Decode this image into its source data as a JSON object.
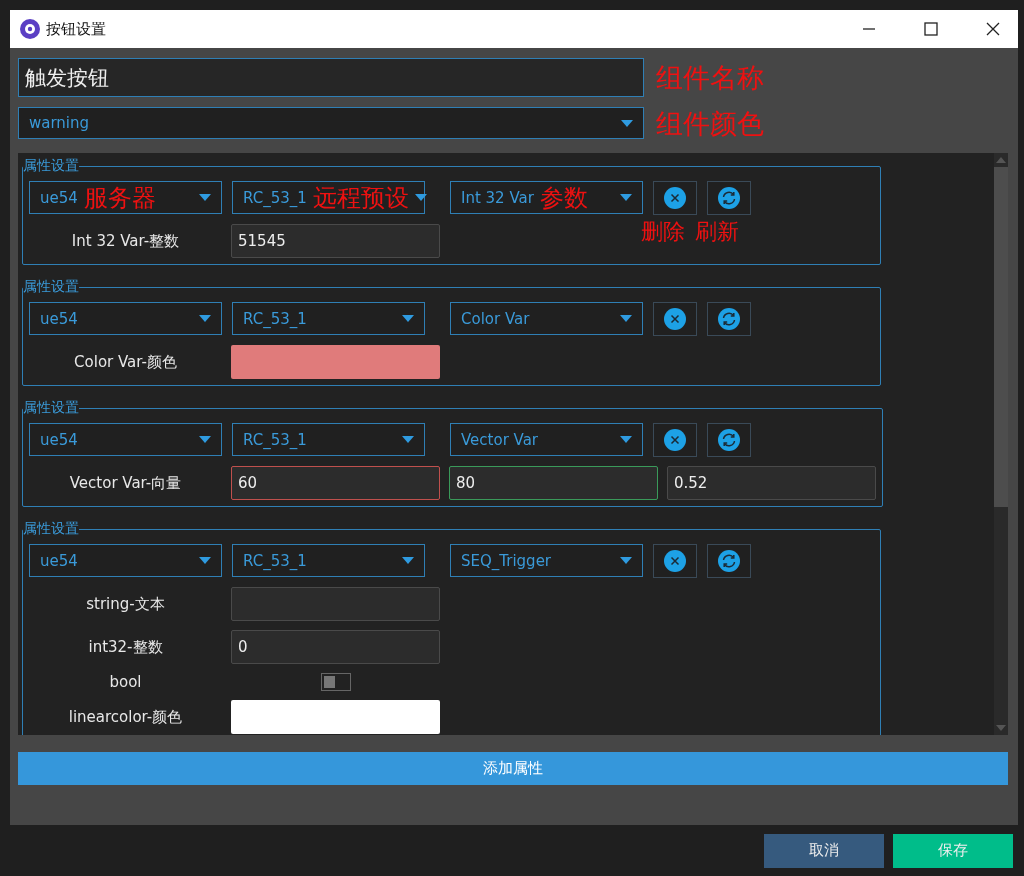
{
  "window": {
    "title": "按钮设置"
  },
  "name_field": {
    "value": "触发按钮",
    "annotation": "组件名称"
  },
  "color_select": {
    "value": "warning",
    "annotation": "组件颜色"
  },
  "groups": [
    {
      "legend": "属性设置",
      "selects": [
        {
          "value": "ue54",
          "annotation": "服务器"
        },
        {
          "value": "RC_53_1",
          "annotation": "远程预设"
        },
        {
          "value": "Int 32 Var",
          "annotation": "参数"
        }
      ],
      "buttons": [
        {
          "kind": "delete",
          "annotation": "删除"
        },
        {
          "kind": "refresh",
          "annotation": "刷新"
        }
      ],
      "fields": [
        {
          "kind": "number",
          "label": "Int 32 Var-整数",
          "value": "51545"
        }
      ]
    },
    {
      "legend": "属性设置",
      "selects": [
        {
          "value": "ue54"
        },
        {
          "value": "RC_53_1"
        },
        {
          "value": "Color Var"
        }
      ],
      "buttons": [
        {
          "kind": "delete"
        },
        {
          "kind": "refresh"
        }
      ],
      "fields": [
        {
          "kind": "color",
          "label": "Color Var-颜色",
          "color": "#e07b7b"
        }
      ]
    },
    {
      "legend": "属性设置",
      "selects": [
        {
          "value": "ue54"
        },
        {
          "value": "RC_53_1"
        },
        {
          "value": "Vector Var"
        }
      ],
      "buttons": [
        {
          "kind": "delete"
        },
        {
          "kind": "refresh"
        }
      ],
      "fields": [
        {
          "kind": "vector",
          "label": "Vector Var-向量",
          "values": [
            {
              "value": "60",
              "color": "#c0504d"
            },
            {
              "value": "80",
              "color": "#3a9a5a"
            },
            {
              "value": "0.52",
              "color": "#4a4a4a"
            }
          ]
        }
      ]
    },
    {
      "legend": "属性设置",
      "selects": [
        {
          "value": "ue54"
        },
        {
          "value": "RC_53_1"
        },
        {
          "value": "SEQ_Trigger"
        }
      ],
      "buttons": [
        {
          "kind": "delete"
        },
        {
          "kind": "refresh"
        }
      ],
      "fields": [
        {
          "kind": "text",
          "label": "string-文本"
        },
        {
          "kind": "number",
          "label": "int32-整数",
          "value": "0"
        },
        {
          "kind": "toggle",
          "label": "bool",
          "on": false
        },
        {
          "kind": "color",
          "label": "linearcolor-颜色",
          "color": "#ffffff"
        }
      ]
    }
  ],
  "add_button": "添加属性",
  "footer_buttons": [
    {
      "kind": "cancel",
      "label": "取消"
    },
    {
      "kind": "save",
      "label": "保存"
    }
  ]
}
